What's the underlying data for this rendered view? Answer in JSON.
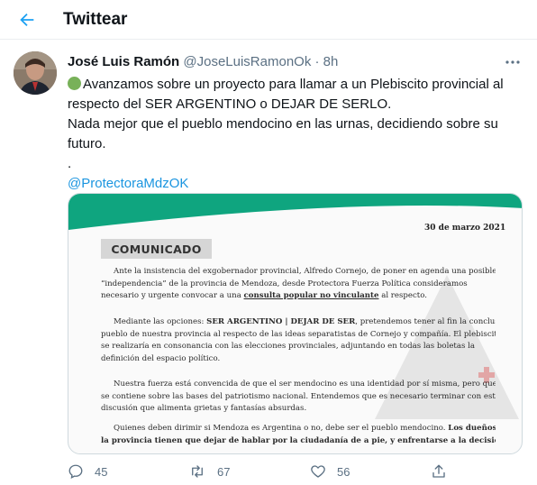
{
  "header": {
    "title": "Twittear",
    "back_icon": "arrow-left-icon",
    "accent": "#1da1f2"
  },
  "tweet": {
    "author_name": "José Luis Ramón",
    "author_handle": "@JoseLuisRamonOk",
    "separator": "·",
    "time": "8h",
    "lines": [
      "Avanzamos sobre un proyecto para llamar a un Plebiscito provincial al",
      "respecto del SER ARGENTINO o DEJAR DE SERLO.",
      "Nada mejor que el pueblo mendocino en las urnas, decidiendo sobre su",
      "futuro.",
      "."
    ],
    "mention": "@ProtectoraMdzOK",
    "mention_color": "#1b95e0"
  },
  "document": {
    "date": "30 de marzo 2021",
    "title": "COMUNICADO",
    "band_color": "#0fa57f",
    "p1": [
      "Ante la insistencia del exgobernador provincial, Alfredo Cornejo, de poner en agenda una posible",
      "“independencia” de la provincia de Mendoza, desde Protectora Fuerza Política consideramos",
      "necesario y urgente convocar a una",
      "consulta popular no vinculante",
      "al respecto."
    ],
    "p2": [
      "Mediante las opciones:",
      "SER ARGENTINO | DEJAR DE SER",
      ", pretendemos tener al fin la conclusión del",
      "pueblo de nuestra provincia al respecto de las ideas separatistas de Cornejo y compañía. El plebiscito",
      "se realizaría en consonancia con las elecciones provinciales, adjuntando en todas las boletas la",
      "definición del espacio político."
    ],
    "p3": [
      "Nuestra fuerza está convencida de que el ser mendocino es una identidad por sí misma, pero que",
      "se contiene sobre las bases del patriotismo nacional. Entendemos que es necesario terminar con esta",
      "discusión que alimenta grietas y fantasías absurdas."
    ],
    "p4": [
      "Quienes deben dirimir si Mendoza es Argentina o no, debe ser el pueblo mendocino.",
      "Los dueños de",
      "la provincia tienen que dejar de hablar por la ciudadanía de a pie, y enfrentarse a la decisión que"
    ]
  },
  "actions": {
    "reply_count": "45",
    "retweet_count": "67",
    "like_count": "56",
    "reply_icon": "reply-icon",
    "retweet_icon": "retweet-icon",
    "like_icon": "heart-icon",
    "share_icon": "share-icon",
    "icon_color": "#5b7083"
  }
}
